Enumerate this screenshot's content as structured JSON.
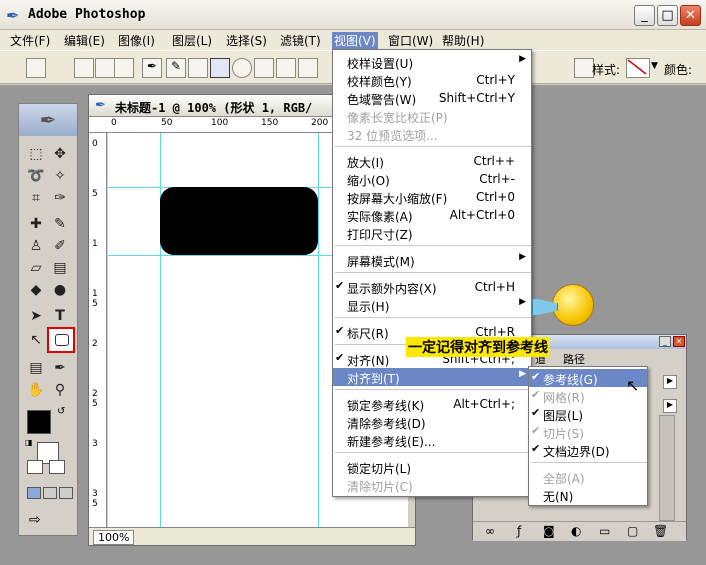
{
  "window": {
    "title": "Adobe Photoshop",
    "minimize": "_",
    "maximize": "□",
    "close": "✕"
  },
  "menubar": [
    "文件(F)",
    "编辑(E)",
    "图像(I)",
    "图层(L)",
    "选择(S)",
    "滤镜(T)",
    "视图(V)",
    "窗口(W)",
    "帮助(H)"
  ],
  "optionsbar": {
    "style_label": "样式:",
    "color_label": "颜色:"
  },
  "document": {
    "title": "未标题-1 @ 100% (形状 1, RGB/",
    "zoom": "100%"
  },
  "ruler": {
    "top_ticks": [
      "0",
      "50",
      "100",
      "150",
      "200"
    ],
    "left_ticks": [
      "0",
      "5",
      "1",
      "1 5",
      "2",
      "2 5",
      "3",
      "3 5"
    ]
  },
  "view_menu": [
    {
      "label": "校样设置(U)",
      "shortcut": "",
      "submenu": true
    },
    {
      "label": "校样颜色(Y)",
      "shortcut": "Ctrl+Y"
    },
    {
      "label": "色域警告(W)",
      "shortcut": "Shift+Ctrl+Y"
    },
    {
      "label": "像素长宽比校正(P)",
      "shortcut": "",
      "disabled": true
    },
    {
      "label": "32 位预览选项...",
      "shortcut": "",
      "disabled": true
    },
    {
      "label": "放大(I)",
      "shortcut": "Ctrl++"
    },
    {
      "label": "缩小(O)",
      "shortcut": "Ctrl+-"
    },
    {
      "label": "按屏幕大小缩放(F)",
      "shortcut": "Ctrl+0"
    },
    {
      "label": "实际像素(A)",
      "shortcut": "Alt+Ctrl+0"
    },
    {
      "label": "打印尺寸(Z)",
      "shortcut": ""
    },
    {
      "label": "屏幕模式(M)",
      "shortcut": "",
      "submenu": true
    },
    {
      "label": "显示额外内容(X)",
      "shortcut": "Ctrl+H",
      "checked": true
    },
    {
      "label": "显示(H)",
      "shortcut": "",
      "submenu": true
    },
    {
      "label": "标尺(R)",
      "shortcut": "Ctrl+R",
      "checked": true
    },
    {
      "label": "对齐(N)",
      "shortcut": "Shift+Ctrl+;",
      "checked": true
    },
    {
      "label": "对齐到(T)",
      "shortcut": "",
      "submenu": true,
      "highlighted": true
    },
    {
      "label": "锁定参考线(K)",
      "shortcut": "Alt+Ctrl+;"
    },
    {
      "label": "清除参考线(D)",
      "shortcut": ""
    },
    {
      "label": "新建参考线(E)...",
      "shortcut": ""
    },
    {
      "label": "锁定切片(L)",
      "shortcut": ""
    },
    {
      "label": "清除切片(C)",
      "shortcut": "",
      "disabled": true
    }
  ],
  "snap_submenu": [
    {
      "label": "参考线(G)",
      "checked": true,
      "highlighted": true
    },
    {
      "label": "网格(R)",
      "checked": true,
      "disabled": true
    },
    {
      "label": "图层(L)",
      "checked": true
    },
    {
      "label": "切片(S)",
      "checked": true,
      "disabled": true
    },
    {
      "label": "文档边界(D)",
      "checked": true
    },
    {
      "label": "全部(A)",
      "disabled": true
    },
    {
      "label": "无(N)"
    }
  ],
  "palette": {
    "tabs": [
      "道",
      "路径"
    ]
  },
  "annotation": "一定记得对齐到参考线",
  "colors": {
    "guide": "#5fd8e8",
    "highlight": "#6b87c5",
    "annotation_bg": "#ffe800",
    "tool_highlight": "#e00000"
  }
}
